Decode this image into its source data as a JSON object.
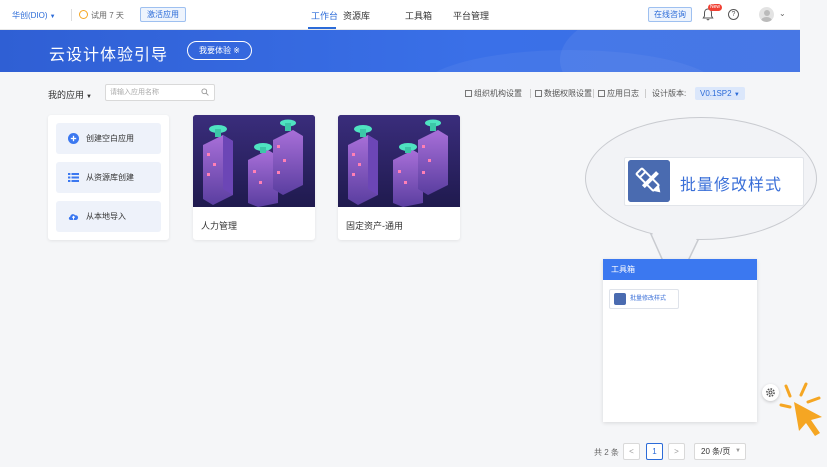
{
  "topbar": {
    "org_name": "华创(DIO)",
    "trial_text": "试用 7 天",
    "activate_label": "激活应用",
    "nav": [
      {
        "label": "工作台",
        "active": true
      },
      {
        "label": "资源库",
        "active": false
      },
      {
        "label": "工具箱",
        "active": false
      },
      {
        "label": "平台管理",
        "active": false
      }
    ],
    "online_label": "在线咨询",
    "badge_new": "New",
    "help_glyph": "?"
  },
  "banner": {
    "title": "云设计体验引导",
    "button_label": "我要体验 ※"
  },
  "toolbar": {
    "my_apps_label": "我的应用",
    "search_placeholder": "请输入应用名称",
    "links": [
      "组织机构设置",
      "数据权限设置",
      "应用日志"
    ],
    "version_label": "设计版本:",
    "version_value": "V0.1SP2"
  },
  "create_menu": {
    "items": [
      {
        "label": "创建空白应用",
        "icon": "plus-circle-icon"
      },
      {
        "label": "从资源库创建",
        "icon": "list-icon"
      },
      {
        "label": "从本地导入",
        "icon": "cloud-upload-icon"
      }
    ]
  },
  "apps": [
    {
      "name": "人力管理"
    },
    {
      "name": "固定资产-通用"
    }
  ],
  "callout": {
    "text": "批量修改样式"
  },
  "toolbox": {
    "title": "工具箱",
    "item_label": "批量修改样式"
  },
  "pagination": {
    "total_text": "共 2 条",
    "prev": "<",
    "current": "1",
    "next": ">",
    "page_size": "20 条/页"
  },
  "colors": {
    "primary": "#2b6bd8",
    "banner": "#3a70e8",
    "pointer": "#f5a623"
  }
}
